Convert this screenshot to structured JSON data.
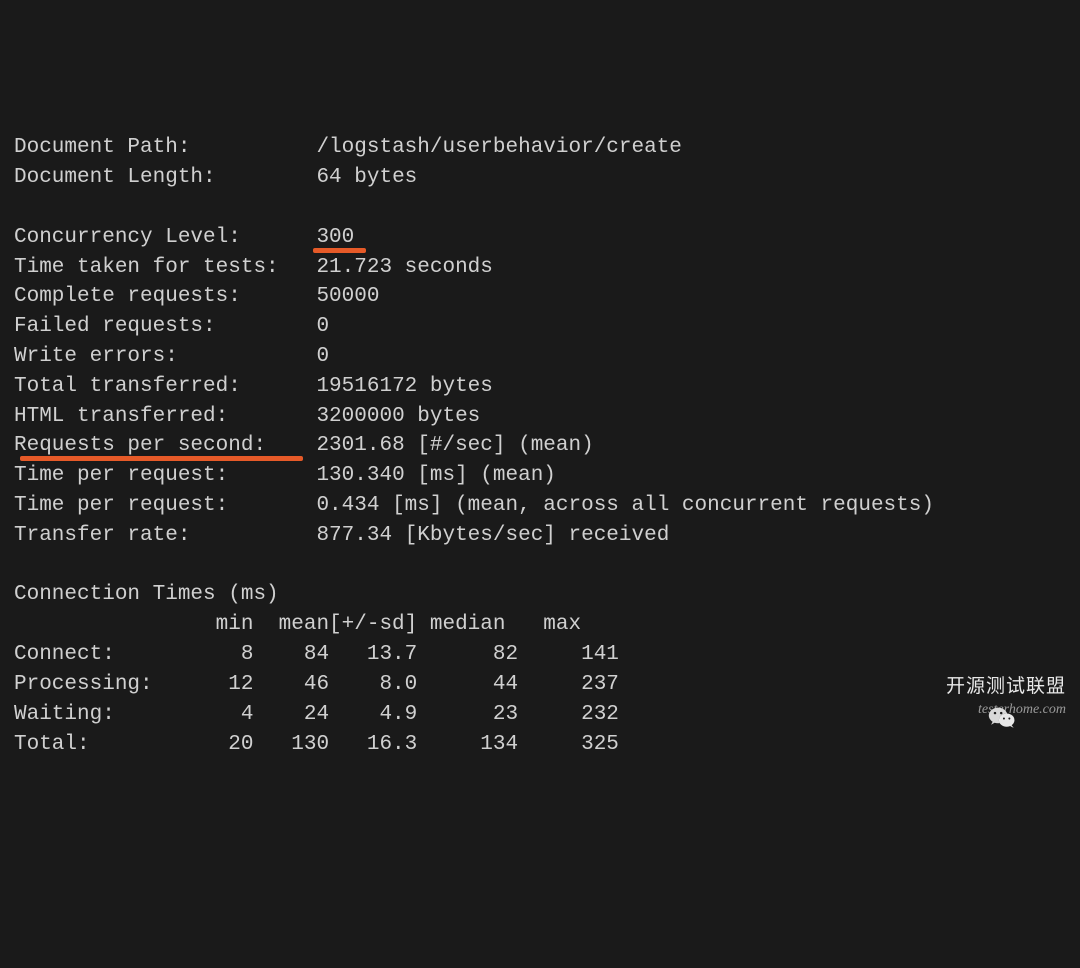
{
  "rows": [
    {
      "label": "Document Path:",
      "value": "/logstash/userbehavior/create"
    },
    {
      "label": "Document Length:",
      "value": "64 bytes"
    },
    {
      "label": "",
      "value": ""
    },
    {
      "label": "Concurrency Level:",
      "value": "300",
      "underline": "u1"
    },
    {
      "label": "Time taken for tests:",
      "value": "21.723 seconds"
    },
    {
      "label": "Complete requests:",
      "value": "50000"
    },
    {
      "label": "Failed requests:",
      "value": "0"
    },
    {
      "label": "Write errors:",
      "value": "0"
    },
    {
      "label": "Total transferred:",
      "value": "19516172 bytes"
    },
    {
      "label": "HTML transferred:",
      "value": "3200000 bytes"
    },
    {
      "label": "Requests per second:",
      "value": "2301.68 [#/sec] (mean)",
      "underline": "u2"
    },
    {
      "label": "Time per request:",
      "value": "130.340 [ms] (mean)"
    },
    {
      "label": "Time per request:",
      "value": "0.434 [ms] (mean, across all concurrent requests)"
    },
    {
      "label": "Transfer rate:",
      "value": "877.34 [Kbytes/sec] received"
    }
  ],
  "connTitle": "Connection Times (ms)",
  "connHeader": {
    "c0": "",
    "c1": "min",
    "c2": "mean",
    "c3": "[+/-sd]",
    "c4": "median",
    "c5": "max"
  },
  "connRows": [
    {
      "label": "Connect:",
      "min": "8",
      "mean": "84",
      "sd": "13.7",
      "median": "82",
      "max": "141"
    },
    {
      "label": "Processing:",
      "min": "12",
      "mean": "46",
      "sd": "8.0",
      "median": "44",
      "max": "237"
    },
    {
      "label": "Waiting:",
      "min": "4",
      "mean": "24",
      "sd": "4.9",
      "median": "23",
      "max": "232"
    },
    {
      "label": "Total:",
      "min": "20",
      "mean": "130",
      "sd": "16.3",
      "median": "134",
      "max": "325"
    }
  ],
  "watermark": {
    "text": "开源测试联盟",
    "url": "testerhome.com"
  }
}
